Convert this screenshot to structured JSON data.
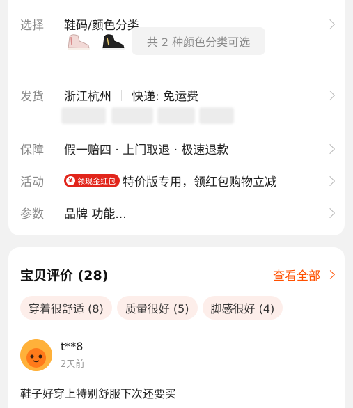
{
  "detail": {
    "select": {
      "label": "选择",
      "value": "鞋码/颜色分类",
      "variant_hint": "共 2 种颜色分类可选"
    },
    "shipping": {
      "label": "发货",
      "location": "浙江杭州",
      "delivery": "快递: 免运费"
    },
    "guarantee": {
      "label": "保障",
      "value": "假一赔四 · 上门取退 · 极速退款"
    },
    "activity": {
      "label": "活动",
      "badge": "领现金红包",
      "badge_icon": "¥",
      "value": "特价版专用，领红包购物立减"
    },
    "params": {
      "label": "参数",
      "value": "品牌 功能..."
    }
  },
  "reviews": {
    "title": "宝贝评价 (28)",
    "view_all": "查看全部",
    "tags": [
      "穿着很舒适 (8)",
      "质量很好 (5)",
      "脚感很好 (4)"
    ],
    "items": [
      {
        "user": "t**8",
        "time": "2天前",
        "text": "鞋子好穿上特别舒服下次还要买"
      }
    ]
  },
  "colors": {
    "accent": "#ff5000",
    "badge_red": "#e1251b",
    "tag_bg": "#fdeeea"
  }
}
